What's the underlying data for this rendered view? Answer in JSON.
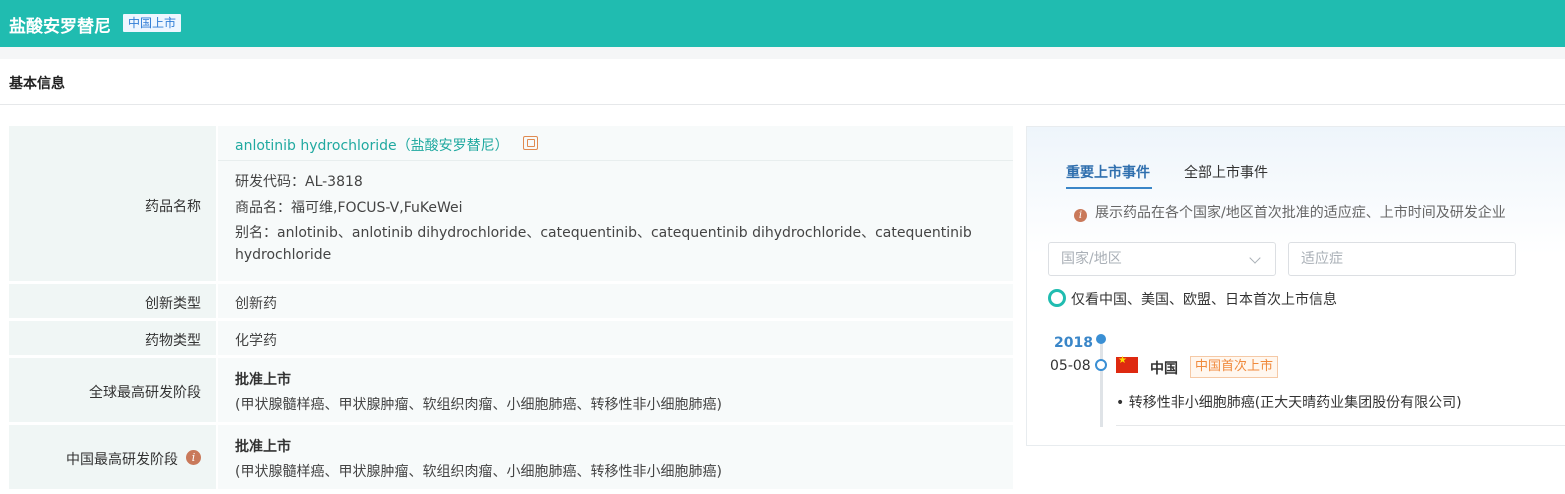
{
  "header": {
    "title": "盐酸安罗替尼",
    "badge": "中国上市"
  },
  "section_title": "基本信息",
  "basic_info": {
    "drug_name": {
      "label": "药品名称",
      "link": "anlotinib hydrochloride（盐酸安罗替尼）",
      "code": "研发代码：AL-3818",
      "trade_name": "商品名：福可维,FOCUS-V,FuKeWei",
      "alias_line1": "别名：anlotinib、anlotinib dihydrochloride、catequentinib、catequentinib dihydrochloride、catequentinib",
      "alias_line2": "hydrochloride"
    },
    "innovation_type": {
      "label": "创新类型",
      "value": "创新药"
    },
    "drug_type": {
      "label": "药物类型",
      "value": "化学药"
    },
    "global_stage": {
      "label": "全球最高研发阶段",
      "value": "批准上市",
      "detail": "(甲状腺髓样癌、甲状腺肿瘤、软组织肉瘤、小细胞肺癌、转移性非小细胞肺癌)"
    },
    "china_stage": {
      "label": "中国最高研发阶段",
      "value": "批准上市",
      "detail": "(甲状腺髓样癌、甲状腺肿瘤、软组织肉瘤、小细胞肺癌、转移性非小细胞肺癌)"
    }
  },
  "market_panel": {
    "tabs": [
      "重要上市事件",
      "全部上市事件"
    ],
    "active_tab": 0,
    "hint": "展示药品在各个国家/地区首次批准的适应症、上市时间及研发企业",
    "country_select_placeholder": "国家/地区",
    "indication_placeholder": "适应症",
    "radio_label": "仅看中国、美国、欧盟、日本首次上市信息",
    "events": [
      {
        "year": "2018",
        "date": "05-08",
        "flag_icon": "china-flag-icon",
        "country": "中国",
        "badge": "中国首次上市",
        "detail": "转移性非小细胞肺癌(正大天晴药业集团股份有限公司)"
      }
    ]
  },
  "colors": {
    "header_bg": "#20bcb0",
    "link": "#20a9a0",
    "tab_active": "#2f6fae",
    "badge_orange": "#f08a3c"
  }
}
